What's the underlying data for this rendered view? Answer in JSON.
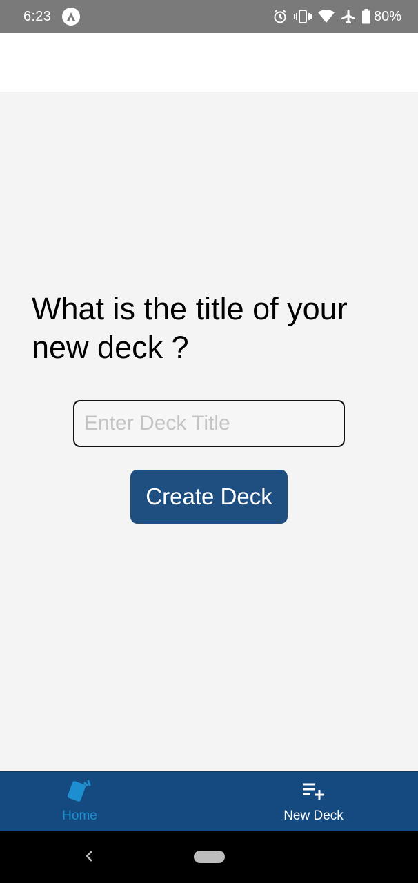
{
  "status_bar": {
    "time": "6:23",
    "battery": "80%",
    "icons": [
      "app-notification-icon",
      "alarm-icon",
      "vibrate-icon",
      "wifi-icon",
      "airplane-icon",
      "battery-icon"
    ]
  },
  "main": {
    "question": "What is the title of your new deck ?",
    "title_input": {
      "placeholder": "Enter Deck Title",
      "value": ""
    },
    "create_button_label": "Create Deck"
  },
  "tab_bar": {
    "tabs": [
      {
        "label": "Home",
        "icon": "cards-icon",
        "active": true
      },
      {
        "label": "New Deck",
        "icon": "playlist-add-icon",
        "active": false
      }
    ]
  },
  "colors": {
    "primary": "#1f4f80",
    "tab_bar": "#154a80",
    "active_tab": "#1d8fd0",
    "background": "#f4f4f4",
    "status_bar": "#7a7a7a"
  },
  "nav_bar": {
    "icons": [
      "back-icon",
      "home-pill-icon"
    ]
  }
}
